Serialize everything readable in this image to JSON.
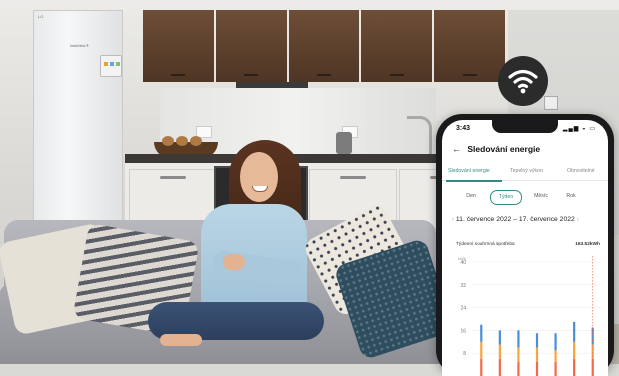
{
  "phone": {
    "status_time": "3:43",
    "status_icons": "▂▄▆ ◒ ▭",
    "back_icon": "←",
    "title": "Sledování energie",
    "tabs": [
      {
        "label": "Sledování energie",
        "active": true
      },
      {
        "label": "Tepelný výkon",
        "active": false
      },
      {
        "label": "Obnovitelné",
        "active": false
      }
    ],
    "periods": [
      {
        "label": "Den",
        "active": false
      },
      {
        "label": "Týden",
        "active": true
      },
      {
        "label": "Měsíc",
        "active": false
      },
      {
        "label": "Rok",
        "active": false
      }
    ],
    "date_range": "11. července 2022 – 17. července 2022",
    "prev_icon": "‹",
    "next_icon": "›",
    "metric_label": "Týdenní souhrnná spotřeba",
    "metric_value": "163.52kWh"
  },
  "fridge": {
    "logo": "LG",
    "brand": "InstaView ®"
  },
  "chart_data": {
    "type": "bar",
    "stacked": true,
    "ylabel": "kWh",
    "y_ticks": [
      8,
      16,
      24,
      32,
      40
    ],
    "ylim": [
      0,
      40
    ],
    "categories": [
      "",
      "",
      "",
      "",
      "",
      "",
      ""
    ],
    "series": [
      {
        "color": "#f26a4b",
        "values": [
          6,
          6,
          5,
          5,
          5,
          6,
          6
        ]
      },
      {
        "color": "#f4a63c",
        "values": [
          6,
          5,
          5,
          5,
          4,
          6,
          5
        ]
      },
      {
        "color": "#4a8fd6",
        "values": [
          6,
          5,
          6,
          5,
          6,
          7,
          6
        ]
      }
    ],
    "marker_category": 6,
    "colors": {
      "marker": "#f26a4b",
      "grid": "#ececec"
    }
  },
  "icons": {
    "wifi": "wifi-icon"
  }
}
